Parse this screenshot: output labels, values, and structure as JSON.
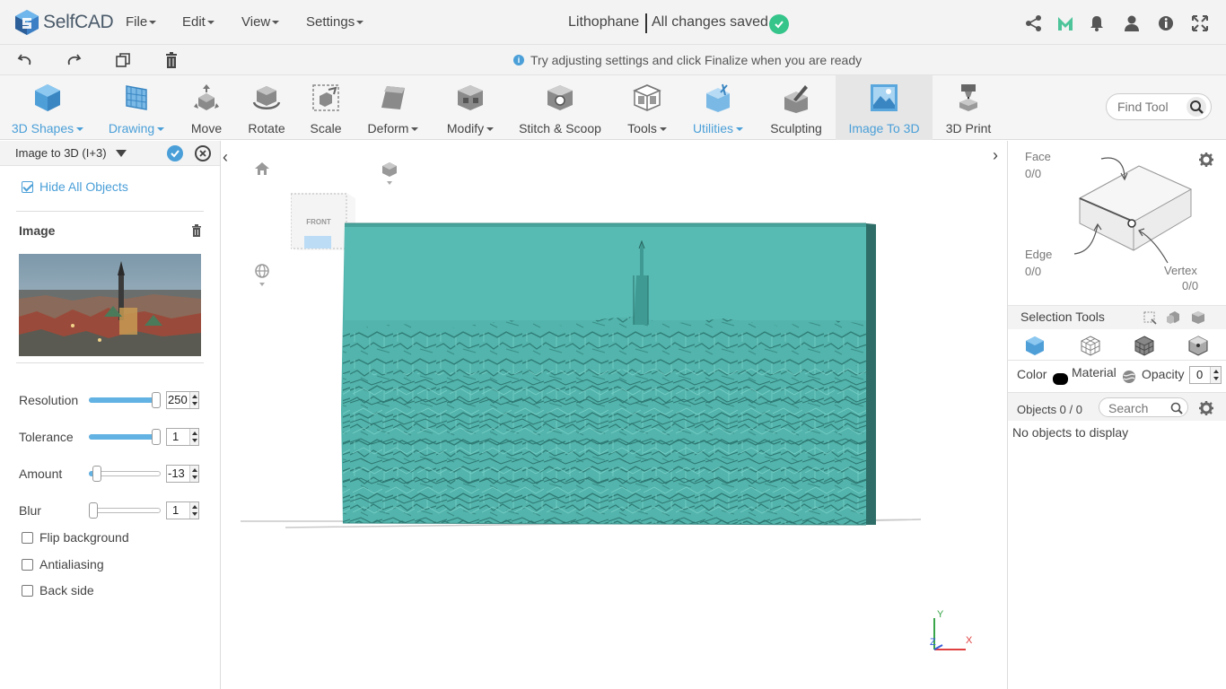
{
  "app": {
    "name": "SelfCAD",
    "doc_title": "Lithophane",
    "save_status": "All changes saved"
  },
  "menus": [
    {
      "label": "File"
    },
    {
      "label": "Edit"
    },
    {
      "label": "View"
    },
    {
      "label": "Settings"
    }
  ],
  "topright_icons": [
    "share-icon",
    "m-logo-icon",
    "bell-icon",
    "user-icon",
    "help-icon",
    "fullscreen-icon"
  ],
  "bar2": {
    "icons": [
      "undo-icon",
      "redo-icon",
      "copy-icon",
      "delete-icon"
    ],
    "hint": "Try adjusting settings and click Finalize when you are ready"
  },
  "toolbar": {
    "tools": [
      {
        "label": "3D Shapes",
        "dropdown": true,
        "color": "blue"
      },
      {
        "label": "Drawing",
        "dropdown": true,
        "color": "blue"
      },
      {
        "label": "Move",
        "dropdown": false
      },
      {
        "label": "Rotate",
        "dropdown": false
      },
      {
        "label": "Scale",
        "dropdown": false
      },
      {
        "label": "Deform",
        "dropdown": true
      },
      {
        "label": "Modify",
        "dropdown": true
      },
      {
        "label": "Stitch & Scoop",
        "dropdown": false
      },
      {
        "label": "Tools",
        "dropdown": true
      },
      {
        "label": "Utilities",
        "dropdown": true,
        "color": "blue"
      },
      {
        "label": "Sculpting",
        "dropdown": false
      },
      {
        "label": "Image To 3D",
        "dropdown": false,
        "active": true
      },
      {
        "label": "3D Print",
        "dropdown": false
      }
    ],
    "find_placeholder": "Find Tool"
  },
  "left_panel": {
    "title": "Image to 3D (I+3)",
    "hide_all_objects": "Hide All Objects",
    "hide_all_checked": true,
    "image_label": "Image",
    "sliders": [
      {
        "label": "Resolution",
        "value": "250",
        "level": 1.0
      },
      {
        "label": "Tolerance",
        "value": "1",
        "level": 1.0
      },
      {
        "label": "Amount",
        "value": "-13",
        "level": 0.06
      },
      {
        "label": "Blur",
        "value": "1",
        "level": 0.0
      }
    ],
    "options": [
      {
        "label": "Flip background",
        "checked": false
      },
      {
        "label": "Antialiasing",
        "checked": false
      },
      {
        "label": "Back side",
        "checked": false
      }
    ]
  },
  "viewport": {
    "front_label": "FRONT",
    "axes": {
      "x": "X",
      "y": "Y",
      "z": "Z"
    }
  },
  "right_panel": {
    "face_label": "Face",
    "face_count": "0/0",
    "edge_label": "Edge",
    "edge_count": "0/0",
    "vertex_label": "Vertex",
    "vertex_count": "0/0",
    "selection_tools": "Selection Tools",
    "color_label": "Color",
    "material_label": "Material",
    "opacity_label": "Opacity",
    "opacity_value": "0",
    "objects_label": "Objects 0 / 0",
    "search_placeholder": "Search",
    "empty_text": "No objects to display"
  },
  "colors": {
    "accent": "#4a9fd8",
    "model": "#4fb5ad",
    "saved_check": "#35c48a"
  }
}
